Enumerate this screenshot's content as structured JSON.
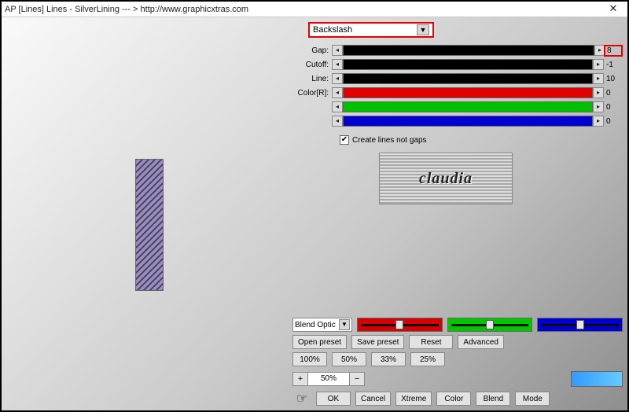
{
  "window": {
    "title": "AP [Lines]  Lines - SilverLining    --- >  http://www.graphicxtras.com",
    "close_glyph": "✕"
  },
  "dropdown": {
    "selected": "Backslash",
    "arrow": "▼"
  },
  "sliders": {
    "gap": {
      "label": "Gap:",
      "value": "8"
    },
    "cutoff": {
      "label": "Cutoff:",
      "value": "-1"
    },
    "line": {
      "label": "Line:",
      "value": "10"
    },
    "colorR": {
      "label": "Color[R]:",
      "value": "0"
    },
    "colorG": {
      "label": "",
      "value": "0"
    },
    "colorB": {
      "label": "",
      "value": "0"
    }
  },
  "mini_left": "◂",
  "mini_right": "▸",
  "checkbox": {
    "checked_glyph": "✔",
    "label": "Create lines not gaps"
  },
  "logo_text": "claudia",
  "blend_options": {
    "label": "Blend Optic",
    "arrow": "▼"
  },
  "preset_buttons": {
    "open": "Open preset",
    "save": "Save preset",
    "reset": "Reset",
    "advanced": "Advanced"
  },
  "zoom_presets": {
    "p100": "100%",
    "p50": "50%",
    "p33": "33%",
    "p25": "25%"
  },
  "zoom_control": {
    "plus": "+",
    "value": "50%",
    "minus": "−"
  },
  "bottom_buttons": {
    "ok": "OK",
    "cancel": "Cancel",
    "xtreme": "Xtreme",
    "color": "Color",
    "blend": "Blend",
    "mode": "Mode"
  },
  "pointer_glyph": "☞"
}
